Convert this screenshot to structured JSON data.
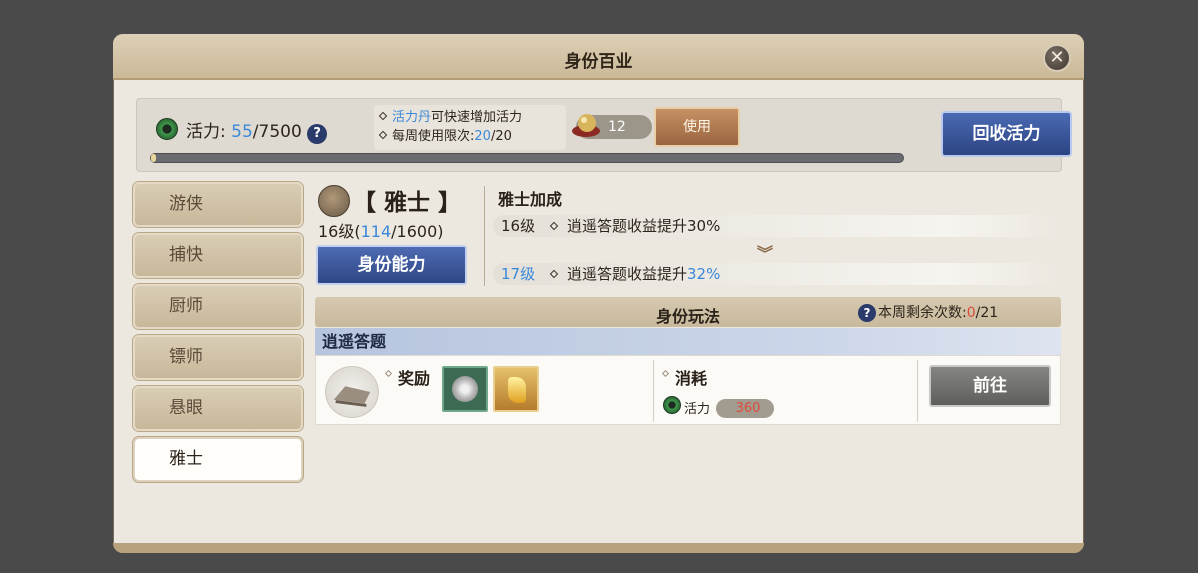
{
  "window": {
    "title": "身份百业",
    "close_icon": "close-icon"
  },
  "stamina": {
    "label": "活力:",
    "current": "55",
    "max": "/7500",
    "help": "?",
    "progress_fraction": 0.0073,
    "tip_line1_highlight": "活力丹",
    "tip_line1_rest": "可快速增加活力",
    "tip_line2_prefix": "每周使用限次:",
    "tip_line2_current": "20",
    "tip_line2_max": "/20",
    "item_count": "12",
    "use_label": "使用",
    "recover_label": "回收活力"
  },
  "sidebar": {
    "items": [
      {
        "label": "游侠",
        "active": false
      },
      {
        "label": "捕快",
        "active": false
      },
      {
        "label": "厨师",
        "active": false
      },
      {
        "label": "镖师",
        "active": false
      },
      {
        "label": "悬眼",
        "active": false
      },
      {
        "label": "雅士",
        "active": true
      }
    ]
  },
  "identity": {
    "name": "【 雅士 】",
    "level_prefix": "16级(",
    "exp_current": "114",
    "exp_rest": "/1600)",
    "ability_label": "身份能力",
    "bonus_title": "雅士加成",
    "bonus_current_level": "16级",
    "bonus_current_text": "逍遥答题收益提升30%",
    "bonus_next_level": "17级",
    "bonus_next_text": "逍遥答题收益提升",
    "bonus_next_value": "32%"
  },
  "gameplay": {
    "title": "身份玩法",
    "weekly_label": "本周剩余次数:",
    "weekly_current": "0",
    "weekly_max": "/21",
    "activity_name": "逍遥答题",
    "reward_label": "奖励",
    "cost_label": "消耗",
    "cost_resource": "活力",
    "cost_value": "360",
    "go_label": "前往"
  }
}
